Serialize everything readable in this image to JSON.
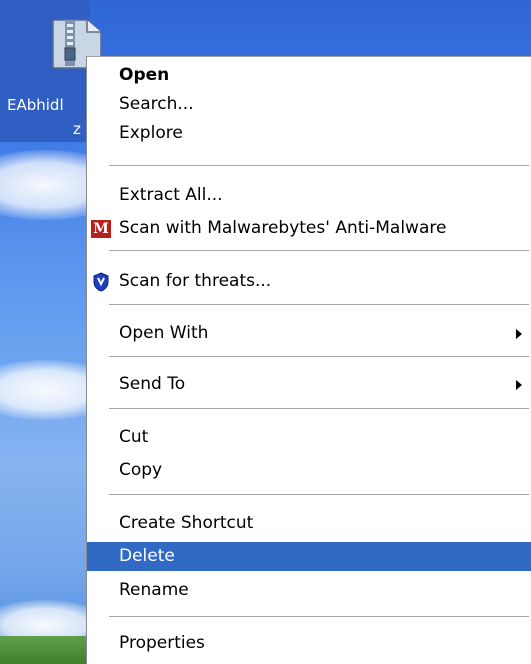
{
  "desktop_icon": {
    "label_line1": "EAbhidl",
    "label_line2": "z",
    "icon": "zip-folder-icon"
  },
  "context_menu": {
    "open": "Open",
    "search": "Search...",
    "explore": "Explore",
    "extract_all": "Extract All...",
    "scan_malwarebytes": "Scan with Malwarebytes' Anti-Malware",
    "malwarebytes_icon_glyph": "M",
    "scan_threats": "Scan for threats...",
    "open_with": "Open With",
    "send_to": "Send To",
    "cut": "Cut",
    "copy": "Copy",
    "create_shortcut": "Create Shortcut",
    "delete": "Delete",
    "rename": "Rename",
    "properties": "Properties",
    "highlighted_item": "Delete"
  },
  "colors": {
    "highlight": "#316ac5",
    "malwarebytes_icon": "#b5201c",
    "shield_icon": "#1f3fbf"
  }
}
